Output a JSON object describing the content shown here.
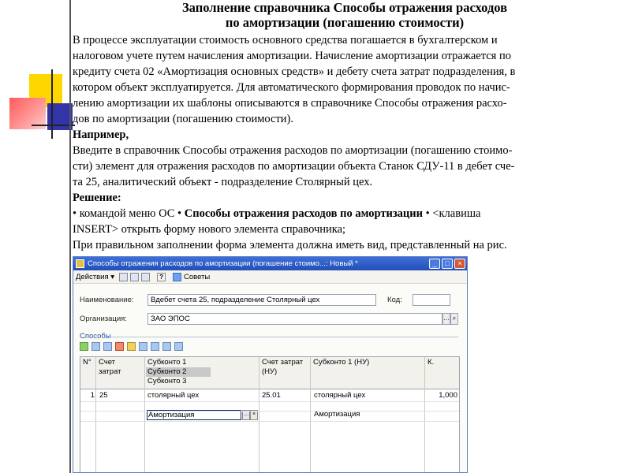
{
  "document": {
    "title_line1": "Заполнение справочника Способы отражения расходов",
    "title_line2": "по амортизации (погашению стоимости)",
    "paragraph1_lines": [
      "В процессе эксплуатации стоимость основного средства погашается в бухгалтерском и",
      "налоговом учете путем начисления амортизации. Начисление амортизации отражается по",
      "кредиту счета 02 «Амортизация основных средств» и дебету счета затрат подразделения, в",
      "котором объект эксплуатируется. Для автоматического формирования проводок по начис-",
      "лению амортизации их шаблоны описываются в справочнике Способы отражения расхо-",
      "дов по амортизации (погашению стоимости)."
    ],
    "example_heading": "Например,",
    "example_lines": [
      "Введите в справочник Способы отражения расходов по амортизации (погашению стоимо-",
      "сти) элемент для отражения расходов по амортизации объекта Станок СДУ-11 в дебет сче-",
      "та 25, аналитический объект - подразделение Столярный цех."
    ],
    "solution_heading": "Решение:",
    "solution_line1_prefix": "• командой меню ОС • ",
    "solution_line1_bold": "Способы отражения расходов по амортизации",
    "solution_line1_suffix": " • <клавиша",
    "solution_line2": "INSERT> открыть форму нового элемента справочника;",
    "solution_line3": "При правильном заполнении форма элемента должна иметь вид, представленный на рис."
  },
  "window": {
    "title": "Способы отражения расходов по амортизации (погашение стоимо...: Новый *",
    "title_buttons": [
      "_",
      "□",
      "×"
    ],
    "menu": {
      "actions": "Действия ▾",
      "help": "?",
      "tips": "Советы"
    },
    "name_label": "Наименование:",
    "name_value": "Вдебет счета 25, подразделение Столярный цех",
    "code_label": "Код:",
    "code_value": "",
    "org_label": "Организация:",
    "org_value": "ЗАО ЭПОС",
    "section_title": "Способы",
    "table": {
      "headers": {
        "num": "N°",
        "account": "Счет\nзатрат",
        "subconto": [
          "Субконто 1",
          "Субконто 2",
          "Субконто 3"
        ],
        "account_nu": "Счет затрат\n(НУ)",
        "subconto_nu": "Субконто 1 (НУ)",
        "k": "К."
      },
      "rows": [
        {
          "num": "1",
          "account": "25",
          "subconto1": "столярный цех",
          "subconto2": "Амортизация",
          "account_nu": "25.01",
          "subconto1_nu": "столярный цех",
          "subconto2_nu": "Амортизация",
          "k": "1,000"
        }
      ]
    }
  }
}
